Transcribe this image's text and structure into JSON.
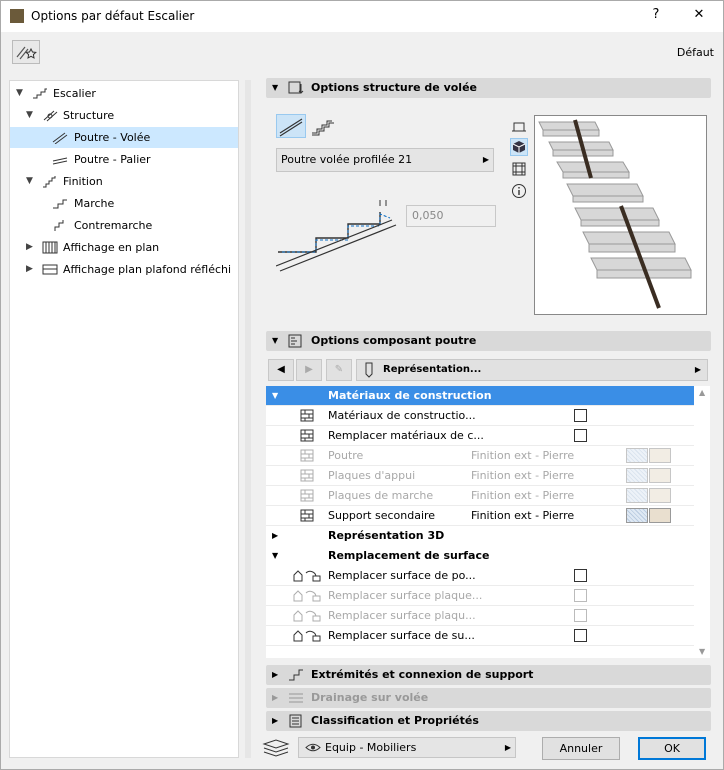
{
  "window": {
    "title": "Options par défaut Escalier",
    "help": "?",
    "close": "✕"
  },
  "toolbar": {
    "default_label": "Défaut"
  },
  "tree": [
    {
      "label": "Escalier",
      "expanded": true
    },
    {
      "label": "Structure",
      "expanded": true
    },
    {
      "label": "Poutre - Volée",
      "selected": true
    },
    {
      "label": "Poutre - Palier"
    },
    {
      "label": "Finition",
      "expanded": true
    },
    {
      "label": "Marche"
    },
    {
      "label": "Contremarche"
    },
    {
      "label": "Affichage en plan",
      "expanded": false
    },
    {
      "label": "Affichage plan plafond réfléchi",
      "expanded": false
    }
  ],
  "sections": {
    "structure": "Options structure de volée",
    "composant": "Options composant poutre",
    "extremites": "Extrémités et connexion de support",
    "drainage": "Drainage sur volée",
    "classification": "Classification et Propriétés"
  },
  "structure": {
    "profile": "Poutre volée profilée 21",
    "thickness": "0,050"
  },
  "navigation": {
    "representation": "Représentation..."
  },
  "table": {
    "groups": [
      "Matériaux de construction",
      "Représentation 3D",
      "Remplacement de surface"
    ],
    "materials_rows": [
      {
        "label": "Matériaux de constructio...",
        "value": "",
        "kind": "checkbox",
        "enabled": true
      },
      {
        "label": "Remplacer matériaux de c...",
        "value": "",
        "kind": "checkbox",
        "enabled": true
      },
      {
        "label": "Poutre",
        "value": "Finition ext - Pierre",
        "kind": "swatch",
        "enabled": false
      },
      {
        "label": "Plaques d'appui",
        "value": "Finition ext - Pierre",
        "kind": "swatch",
        "enabled": false
      },
      {
        "label": "Plaques de marche",
        "value": "Finition ext - Pierre",
        "kind": "swatch",
        "enabled": false
      },
      {
        "label": "Support secondaire",
        "value": "Finition ext - Pierre",
        "kind": "swatch",
        "enabled": true
      }
    ],
    "surface_rows": [
      {
        "label": "Remplacer surface de po...",
        "enabled": true
      },
      {
        "label": "Remplacer surface plaque...",
        "enabled": false
      },
      {
        "label": "Remplacer surface plaqu...",
        "enabled": false
      },
      {
        "label": "Remplacer surface de su...",
        "enabled": true
      }
    ]
  },
  "footer": {
    "layer": "Equip - Mobiliers",
    "cancel": "Annuler",
    "ok": "OK"
  },
  "colors": {
    "selection": "#cce8ff",
    "header_blue": "#3a8ee6",
    "ok_border": "#0078d7"
  }
}
